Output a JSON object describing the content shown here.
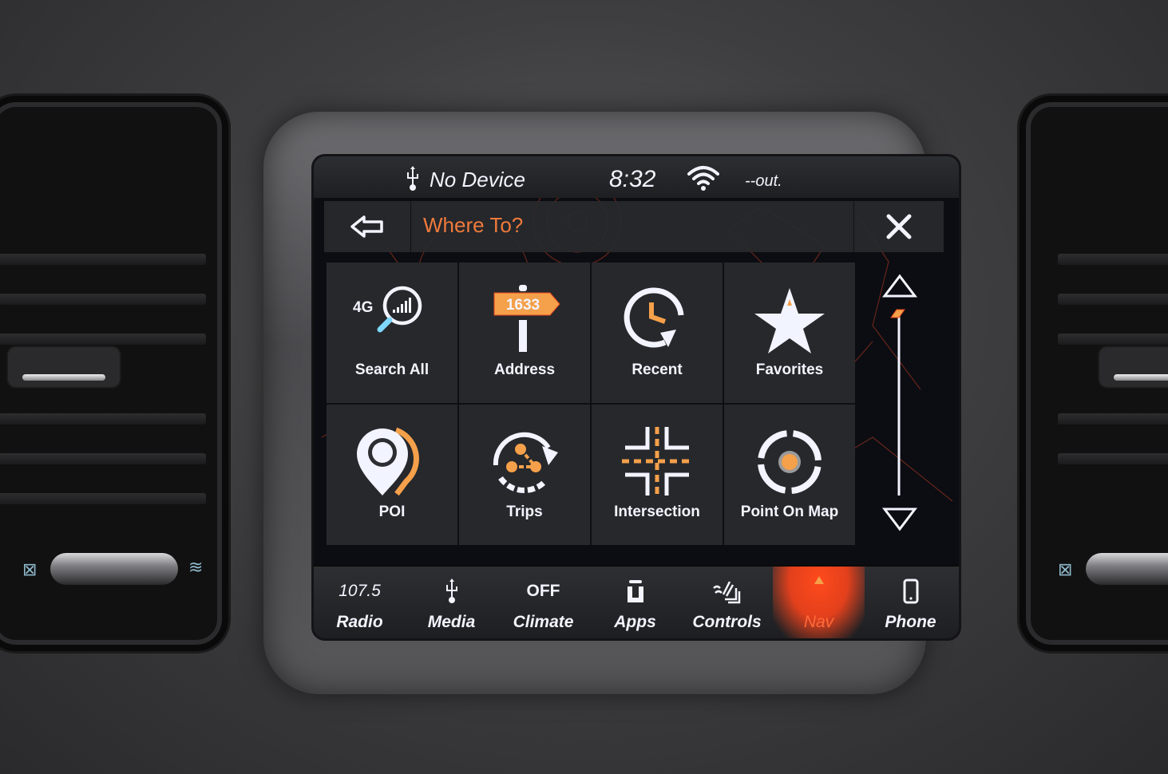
{
  "status_bar": {
    "usb_icon": "usb-icon",
    "device_text": "No Device",
    "time": "8:32",
    "wifi_icon": "wifi-icon",
    "temperature_text": "--out."
  },
  "header": {
    "back_icon": "back-arrow-icon",
    "title": "Where To?",
    "close_icon": "close-icon"
  },
  "menu": {
    "tiles": [
      {
        "label": "Search All",
        "icon": "search-4g-icon",
        "badge": "4G"
      },
      {
        "label": "Address",
        "icon": "address-sign-icon",
        "sign_number": "1633"
      },
      {
        "label": "Recent",
        "icon": "recent-clock-icon"
      },
      {
        "label": "Favorites",
        "icon": "star-icon"
      },
      {
        "label": "POI",
        "icon": "map-pin-icon"
      },
      {
        "label": "Trips",
        "icon": "trips-icon"
      },
      {
        "label": "Intersection",
        "icon": "intersection-icon"
      },
      {
        "label": "Point On Map",
        "icon": "target-icon"
      }
    ]
  },
  "scroll": {
    "up_icon": "scroll-up-icon",
    "down_icon": "scroll-down-icon",
    "position_fraction": 0
  },
  "nav_bar": {
    "items": [
      {
        "top": "107.5",
        "label": "Radio"
      },
      {
        "top_icon": "usb-icon",
        "label": "Media"
      },
      {
        "top": "OFF",
        "label": "Climate"
      },
      {
        "top_icon": "apps-icon",
        "label": "Apps"
      },
      {
        "top_icon": "controls-icon",
        "label": "Controls"
      },
      {
        "top_icon": "active-indicator-icon",
        "label": "Nav",
        "active": true
      },
      {
        "top_icon": "phone-icon",
        "label": "Phone"
      }
    ]
  },
  "colors": {
    "accent": "#f07a3c",
    "icon_orange": "#f5a04a",
    "active_nav": "#ff4a1c",
    "text": "#f2f4ff"
  }
}
